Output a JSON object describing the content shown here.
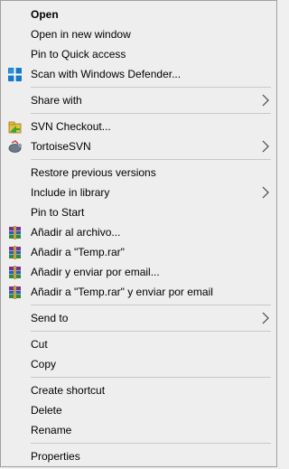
{
  "menu": {
    "group1": [
      {
        "label": "Open"
      },
      {
        "label": "Open in new window"
      },
      {
        "label": "Pin to Quick access"
      },
      {
        "label": "Scan with Windows Defender...",
        "icon": "windows-defender-shield-icon"
      }
    ],
    "share_with": {
      "label": "Share with"
    },
    "group2": [
      {
        "label": "SVN Checkout...",
        "icon": "svn-checkout-icon"
      },
      {
        "label": "TortoiseSVN",
        "icon": "tortoisesvn-icon"
      }
    ],
    "group3": [
      {
        "label": "Restore previous versions"
      },
      {
        "label": "Include in library"
      },
      {
        "label": "Pin to Start"
      },
      {
        "label": "Añadir al archivo...",
        "icon": "winrar-icon"
      },
      {
        "label": "Añadir a \"Temp.rar\"",
        "icon": "winrar-icon"
      },
      {
        "label": "Añadir y enviar por email...",
        "icon": "winrar-icon"
      },
      {
        "label": "Añadir a \"Temp.rar\" y enviar por email",
        "icon": "winrar-icon"
      }
    ],
    "send_to": {
      "label": "Send to"
    },
    "group4": [
      {
        "label": "Cut"
      },
      {
        "label": "Copy"
      }
    ],
    "group5": [
      {
        "label": "Create shortcut"
      },
      {
        "label": "Delete"
      },
      {
        "label": "Rename"
      }
    ],
    "group6": [
      {
        "label": "Properties"
      }
    ]
  },
  "colors": {
    "background": "#eeeeee",
    "border": "#a0a0a0",
    "separator": "#c8c8c8",
    "defender_blue": "#1a78c8",
    "winrar_purple": "#7b2f8e"
  }
}
